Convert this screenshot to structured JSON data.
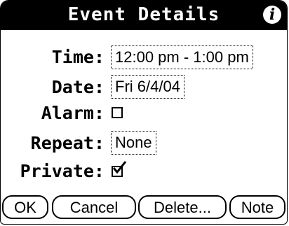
{
  "dialog": {
    "title": "Event Details",
    "info_icon": "i"
  },
  "fields": {
    "time": {
      "label": "Time:",
      "value": "12:00 pm - 1:00 pm"
    },
    "date": {
      "label": "Date:",
      "value": "Fri 6/4/04"
    },
    "alarm": {
      "label": "Alarm:",
      "checked": false
    },
    "repeat": {
      "label": "Repeat:",
      "value": "None"
    },
    "private": {
      "label": "Private:",
      "checked": true
    }
  },
  "buttons": {
    "ok": "OK",
    "cancel": "Cancel",
    "delete": "Delete...",
    "note": "Note"
  },
  "icons": {
    "info": "info-icon",
    "alarm_checkbox": "empty-checkbox",
    "private_checkbox": "checked-checkbox"
  }
}
